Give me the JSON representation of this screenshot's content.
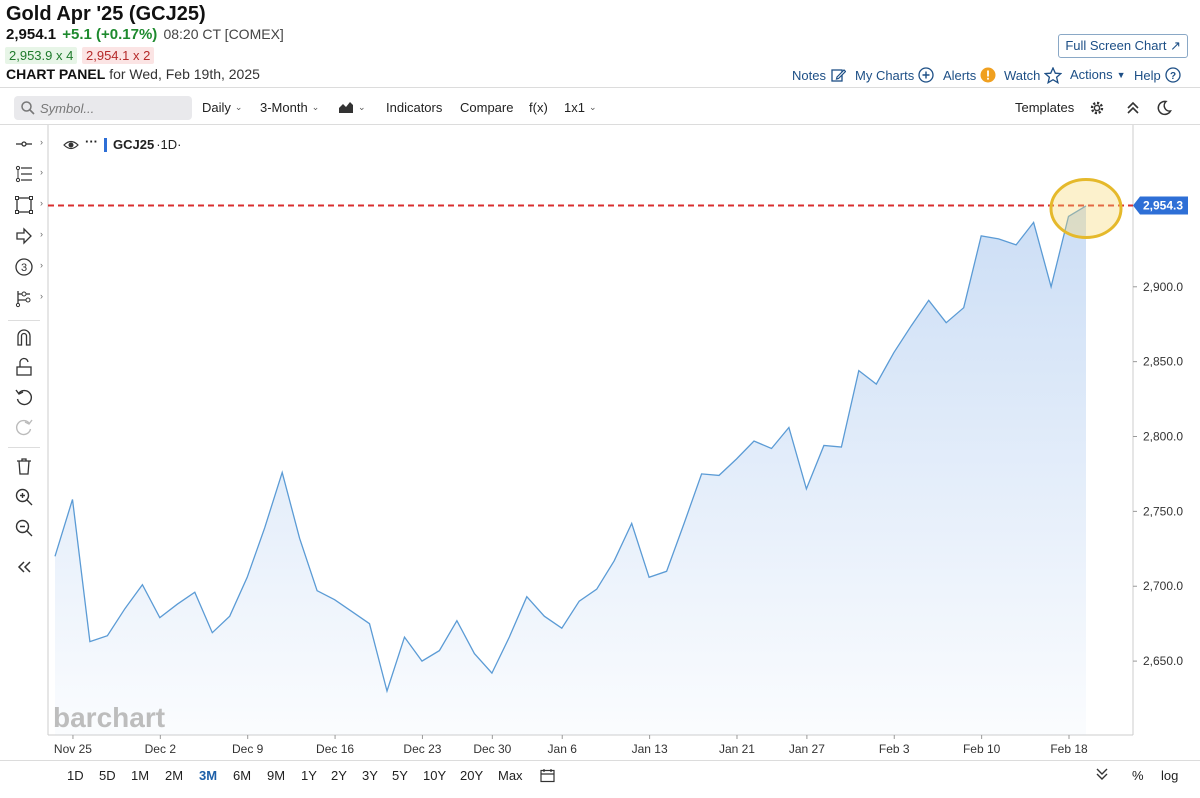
{
  "header": {
    "title": "Gold Apr '25 (GCJ25)",
    "last": "2,954.1",
    "change": "+5.1 (+0.17%)",
    "time": "08:20 CT [COMEX]",
    "bid": "2,953.9 x 4",
    "ask": "2,954.1 x 2",
    "panel_label": "CHART PANEL",
    "panel_date": "for Wed, Feb 19th, 2025",
    "fullscreen_label": "Full Screen Chart",
    "links": {
      "notes": "Notes",
      "mycharts": "My Charts",
      "alerts": "Alerts",
      "watch": "Watch",
      "actions": "Actions",
      "help": "Help"
    }
  },
  "toolbar": {
    "search_placeholder": "Symbol...",
    "period": "Daily",
    "range": "3-Month",
    "indicators": "Indicators",
    "compare": "Compare",
    "fx": "f(x)",
    "layout": "1x1",
    "templates": "Templates"
  },
  "legend": {
    "symbol": "GCJ25",
    "interval": "·1D·",
    "dots": "···"
  },
  "watermark": "barchart",
  "bottom": {
    "ranges": [
      "1D",
      "5D",
      "1M",
      "2M",
      "3M",
      "6M",
      "9M",
      "1Y",
      "2Y",
      "3Y",
      "5Y",
      "10Y",
      "20Y",
      "Max"
    ],
    "active": "3M",
    "percent": "%",
    "log": "log"
  },
  "colors": {
    "line": "#5b9bd5",
    "area_top": "#c9dcf5",
    "price_line": "#d93030",
    "price_tag": "#2e6fd6",
    "highlight": "#f5d76e",
    "accent": "#1d4f86"
  },
  "chart_data": {
    "type": "area",
    "x_labels": [
      "Nov 25",
      "Dec 2",
      "Dec 9",
      "Dec 16",
      "Dec 23",
      "Dec 30",
      "Jan 6",
      "Jan 13",
      "Jan 21",
      "Jan 27",
      "Feb 3",
      "Feb 10",
      "Feb 18"
    ],
    "y_ticks": [
      "2,650.0",
      "2,700.0",
      "2,750.0",
      "2,800.0",
      "2,850.0",
      "2,900.0"
    ],
    "ylim": [
      2612,
      2978
    ],
    "current_price_label": "2,954.3",
    "current_price": 2954.3,
    "series": [
      {
        "values": [
          2720,
          2758,
          2663,
          2667,
          2685,
          2701,
          2679,
          2688,
          2696,
          2669,
          2680,
          2706,
          2739,
          2776,
          2732,
          2697,
          2691,
          2683,
          2675,
          2630,
          2666,
          2650,
          2657,
          2677,
          2655,
          2642,
          2666,
          2693,
          2680,
          2672,
          2690,
          2698,
          2717,
          2742,
          2706,
          2710,
          2742,
          2775,
          2774,
          2785,
          2797,
          2792,
          2806,
          2765,
          2794,
          2793,
          2844,
          2835,
          2856,
          2874,
          2891,
          2876,
          2886,
          2934,
          2932,
          2928,
          2943,
          2900,
          2947,
          2954
        ]
      }
    ]
  }
}
